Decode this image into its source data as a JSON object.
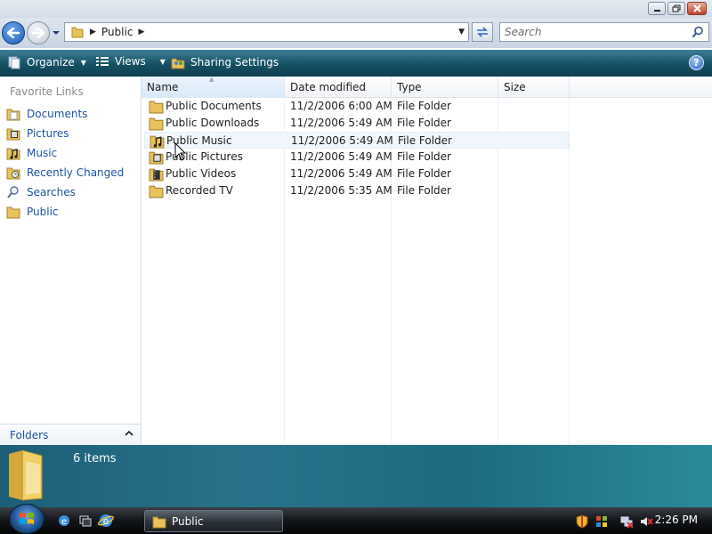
{
  "address": {
    "crumbs": [
      "Public"
    ]
  },
  "search": {
    "placeholder": "Search"
  },
  "toolbar": {
    "organize_label": "Organize",
    "views_label": "Views",
    "sharing_label": "Sharing Settings",
    "help_label": "?"
  },
  "nav": {
    "header": "Favorite Links",
    "items": [
      {
        "label": "Documents",
        "icon": "folder-documents-icon"
      },
      {
        "label": "Pictures",
        "icon": "folder-pictures-icon"
      },
      {
        "label": "Music",
        "icon": "folder-music-icon"
      },
      {
        "label": "Recently Changed",
        "icon": "folder-recent-icon"
      },
      {
        "label": "Searches",
        "icon": "search-icon"
      },
      {
        "label": "Public",
        "icon": "folder-icon"
      }
    ],
    "folders_label": "Folders"
  },
  "columns": [
    "Name",
    "Date modified",
    "Type",
    "Size"
  ],
  "files": [
    {
      "name": "Public Documents",
      "date": "11/2/2006 6:00 AM",
      "type": "File Folder",
      "size": "",
      "icon": "folder-icon"
    },
    {
      "name": "Public Downloads",
      "date": "11/2/2006 5:49 AM",
      "type": "File Folder",
      "size": "",
      "icon": "folder-icon"
    },
    {
      "name": "Public Music",
      "date": "11/2/2006 5:49 AM",
      "type": "File Folder",
      "size": "",
      "icon": "folder-music-icon"
    },
    {
      "name": "Public Pictures",
      "date": "11/2/2006 5:49 AM",
      "type": "File Folder",
      "size": "",
      "icon": "folder-pictures-icon"
    },
    {
      "name": "Public Videos",
      "date": "11/2/2006 5:49 AM",
      "type": "File Folder",
      "size": "",
      "icon": "folder-videos-icon"
    },
    {
      "name": "Recorded TV",
      "date": "11/2/2006 5:35 AM",
      "type": "File Folder",
      "size": "",
      "icon": "folder-icon"
    }
  ],
  "details": {
    "count": "6 items"
  },
  "taskbar": {
    "window_label": "Public",
    "clock": "2:26 PM"
  },
  "colors": {
    "link_blue": "#1f53a5",
    "toolbar_teal": "#165063",
    "folder_yellow": "#e8c25a"
  }
}
